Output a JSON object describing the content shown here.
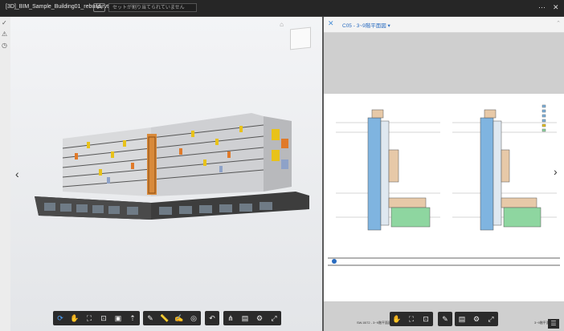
{
  "header": {
    "title": "[3D]_BIM_Sample_Building01_rebuild.rvt",
    "version": "V4",
    "comment_placeholder": "セットが割り当てられていません",
    "more_icon": "ellipsis-icon",
    "close_icon": "close-icon"
  },
  "left_tools": [
    "check-icon",
    "warning-icon",
    "clock-icon"
  ],
  "viewer3d": {
    "toolbar_groups": [
      [
        "orbit-icon",
        "pan-icon",
        "fit-icon",
        "zoom-window-icon",
        "section-box-icon",
        "first-person-icon"
      ],
      [
        "markup-icon",
        "measure-icon",
        "annotate-icon",
        "visibility-icon"
      ],
      [
        "undo-icon"
      ],
      [
        "model-tree-icon",
        "properties-icon",
        "settings-icon",
        "fullscreen-icon"
      ]
    ]
  },
  "sheet": {
    "selector": "C05 - 3~9階平面図",
    "title_left": "SW-0072 - 3~9階平面図 (3F/4F)",
    "title_right": "3~9階平面図",
    "toolbar": [
      "pan-icon",
      "fit-icon",
      "zoom-window-icon",
      "markup-icon",
      "save-icon",
      "settings-icon",
      "fullscreen-icon"
    ],
    "menu_icon": "menu-icon"
  },
  "colors": {
    "accent": "#4da3ff",
    "facade_yellow": "#e8c21a",
    "facade_orange": "#e07a2a",
    "plan_blue": "#7fb4e0",
    "plan_green": "#8ed6a0"
  }
}
